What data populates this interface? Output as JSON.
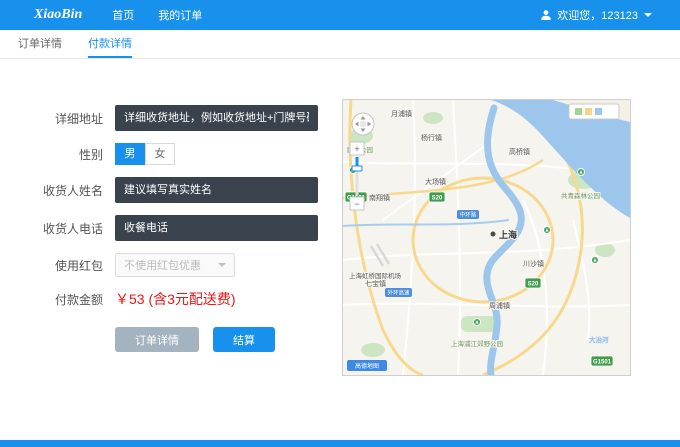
{
  "theme": {
    "accent": "#1791ec",
    "input_bg": "#39424d",
    "price_red": "#f01414"
  },
  "header": {
    "brand": "XiaoBin",
    "nav": [
      {
        "label": "首页"
      },
      {
        "label": "我的订单"
      }
    ],
    "user": {
      "text": "欢迎您，123123"
    }
  },
  "tabs": [
    {
      "label": "订单详情",
      "active": false
    },
    {
      "label": "付款详情",
      "active": true
    }
  ],
  "form": {
    "address": {
      "label": "详细地址",
      "placeholder": "详细收货地址，例如收货地址+门牌号码+楼"
    },
    "gender": {
      "label": "性别",
      "options": [
        {
          "label": "男",
          "selected": true
        },
        {
          "label": "女",
          "selected": false
        }
      ]
    },
    "name": {
      "label": "收货人姓名",
      "placeholder": "建议填写真实姓名"
    },
    "phone": {
      "label": "收货人电话",
      "placeholder": "收餐电话"
    },
    "coupon": {
      "label": "使用红包",
      "value": "不使用红包优惠"
    },
    "amount": {
      "label": "付款金额",
      "value": "￥53 (含3元配送费)"
    },
    "buttons": {
      "details": "订单详情",
      "checkout": "结算"
    }
  },
  "map": {
    "labels": [
      {
        "text": "月浦镇",
        "type": "town"
      },
      {
        "text": "杨行镇",
        "type": "town"
      },
      {
        "text": "高桥镇",
        "type": "town"
      },
      {
        "text": "大场镇",
        "type": "town"
      },
      {
        "text": "南翔镇",
        "type": "town"
      },
      {
        "text": "七宝镇",
        "type": "town"
      },
      {
        "text": "川沙镇",
        "type": "town"
      },
      {
        "text": "周浦镇",
        "type": "town"
      },
      {
        "text": "上海",
        "type": "city"
      },
      {
        "text": "上海虹桥国际机场",
        "type": "poi"
      },
      {
        "text": "共青森林公园",
        "type": "park"
      },
      {
        "text": "上海浦江郊野公园",
        "type": "park"
      },
      {
        "text": "顾村公园",
        "type": "park"
      },
      {
        "text": "大治河",
        "type": "water"
      }
    ],
    "shields": [
      {
        "text": "G1501"
      },
      {
        "text": "S20"
      },
      {
        "text": "S20"
      },
      {
        "text": "G1501"
      },
      {
        "text": "G40"
      }
    ],
    "road_labels": [
      {
        "text": "中环路"
      },
      {
        "text": "外环高速"
      }
    ],
    "controls": {
      "zoom_in": "+",
      "zoom_out": "−"
    },
    "watermark": "高德地图"
  }
}
